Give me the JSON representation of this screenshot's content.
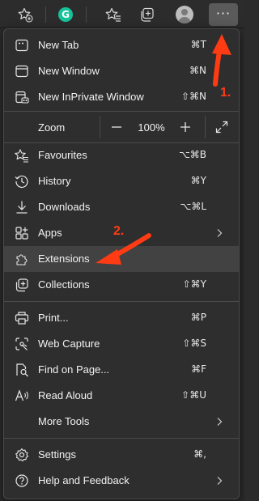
{
  "toolbar": {
    "items": [
      {
        "icon": "star-add-icon"
      },
      {
        "icon": "grammarly-icon",
        "letter": "G"
      },
      {
        "icon": "favorites-icon"
      },
      {
        "icon": "collections-icon"
      },
      {
        "icon": "profile-avatar-icon"
      },
      {
        "icon": "more-options-icon",
        "glyph": "···"
      }
    ]
  },
  "menu": {
    "new_tab": {
      "label": "New Tab",
      "shortcut": "⌘T",
      "icon": "new-tab-icon"
    },
    "new_window": {
      "label": "New Window",
      "shortcut": "⌘N",
      "icon": "new-window-icon"
    },
    "new_inprivate": {
      "label": "New InPrivate Window",
      "shortcut": "⇧⌘N",
      "icon": "inprivate-icon"
    },
    "zoom": {
      "label": "Zoom",
      "minus": "—",
      "value": "100%",
      "plus": "+",
      "fullscreen_icon": "fullscreen-icon"
    },
    "favourites": {
      "label": "Favourites",
      "shortcut": "⌥⌘B",
      "icon": "favourites-icon"
    },
    "history": {
      "label": "History",
      "shortcut": "⌘Y",
      "icon": "history-icon"
    },
    "downloads": {
      "label": "Downloads",
      "shortcut": "⌥⌘L",
      "icon": "downloads-icon"
    },
    "apps": {
      "label": "Apps",
      "icon": "apps-icon",
      "submenu": true
    },
    "extensions": {
      "label": "Extensions",
      "icon": "extensions-icon",
      "highlighted": true
    },
    "collections": {
      "label": "Collections",
      "shortcut": "⇧⌘Y",
      "icon": "collections-icon"
    },
    "print": {
      "label": "Print...",
      "shortcut": "⌘P",
      "icon": "print-icon"
    },
    "web_capture": {
      "label": "Web Capture",
      "shortcut": "⇧⌘S",
      "icon": "web-capture-icon"
    },
    "find_on_page": {
      "label": "Find on Page...",
      "shortcut": "⌘F",
      "icon": "find-icon"
    },
    "read_aloud": {
      "label": "Read Aloud",
      "shortcut": "⇧⌘U",
      "icon": "read-aloud-icon"
    },
    "more_tools": {
      "label": "More Tools",
      "submenu": true
    },
    "settings": {
      "label": "Settings",
      "shortcut": "⌘,",
      "icon": "settings-icon"
    },
    "help_feedback": {
      "label": "Help and Feedback",
      "icon": "help-icon",
      "submenu": true
    }
  },
  "annotations": {
    "step1": "1.",
    "step2": "2.",
    "color": "#ff3b14"
  },
  "colors": {
    "menu_bg": "#2e2e2e",
    "highlight_bg": "#424242",
    "text": "#f2f2f2",
    "active_button_bg": "#5a5a5a"
  }
}
